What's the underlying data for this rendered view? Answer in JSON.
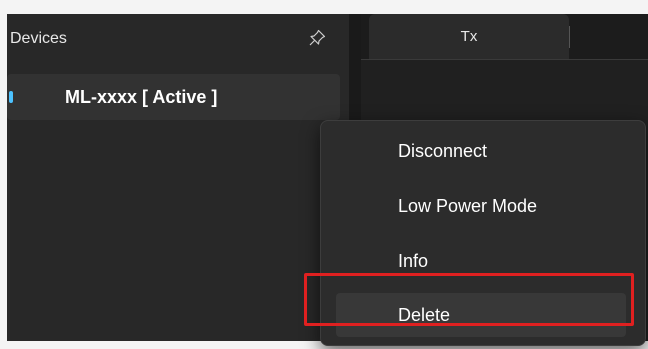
{
  "devices_panel": {
    "title": "Devices",
    "pin_icon": "pin-icon",
    "devices": [
      {
        "label": "ML-xxxx [ Active ]",
        "active": true,
        "indicator_color": "#4cc2ff"
      }
    ]
  },
  "tabs": [
    {
      "label": "Tx",
      "selected": true
    }
  ],
  "context_menu": {
    "items": [
      {
        "label": "Disconnect"
      },
      {
        "label": "Low Power Mode"
      },
      {
        "label": "Info"
      },
      {
        "label": "Delete",
        "highlighted": true
      }
    ]
  },
  "colors": {
    "accent": "#4cc2ff",
    "highlight_border": "#e02020",
    "menu_background": "#2c2c2c",
    "panel_background": "#282828"
  }
}
